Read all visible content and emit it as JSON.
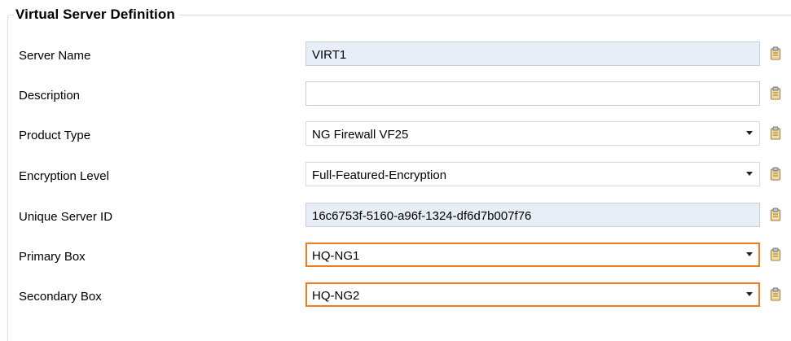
{
  "group": {
    "title": "Virtual Server Definition"
  },
  "fields": [
    {
      "label": "Server Name",
      "value": "VIRT1"
    },
    {
      "label": "Description",
      "value": ""
    },
    {
      "label": "Product Type",
      "value": "NG Firewall VF25"
    },
    {
      "label": "Encryption Level",
      "value": "Full-Featured-Encryption"
    },
    {
      "label": "Unique Server ID",
      "value": "16c6753f-5160-a96f-1324-df6d7b007f76"
    },
    {
      "label": "Primary Box",
      "value": "HQ-NG1"
    },
    {
      "label": "Secondary Box",
      "value": "HQ-NG2"
    }
  ],
  "icons": {
    "dropdown": "chevron-down-icon",
    "clipboard": "clipboard-icon"
  },
  "colors": {
    "highlight_border": "#f07c1a",
    "readonly_background": "#e8eef8",
    "group_border": "#d5dfe5"
  }
}
